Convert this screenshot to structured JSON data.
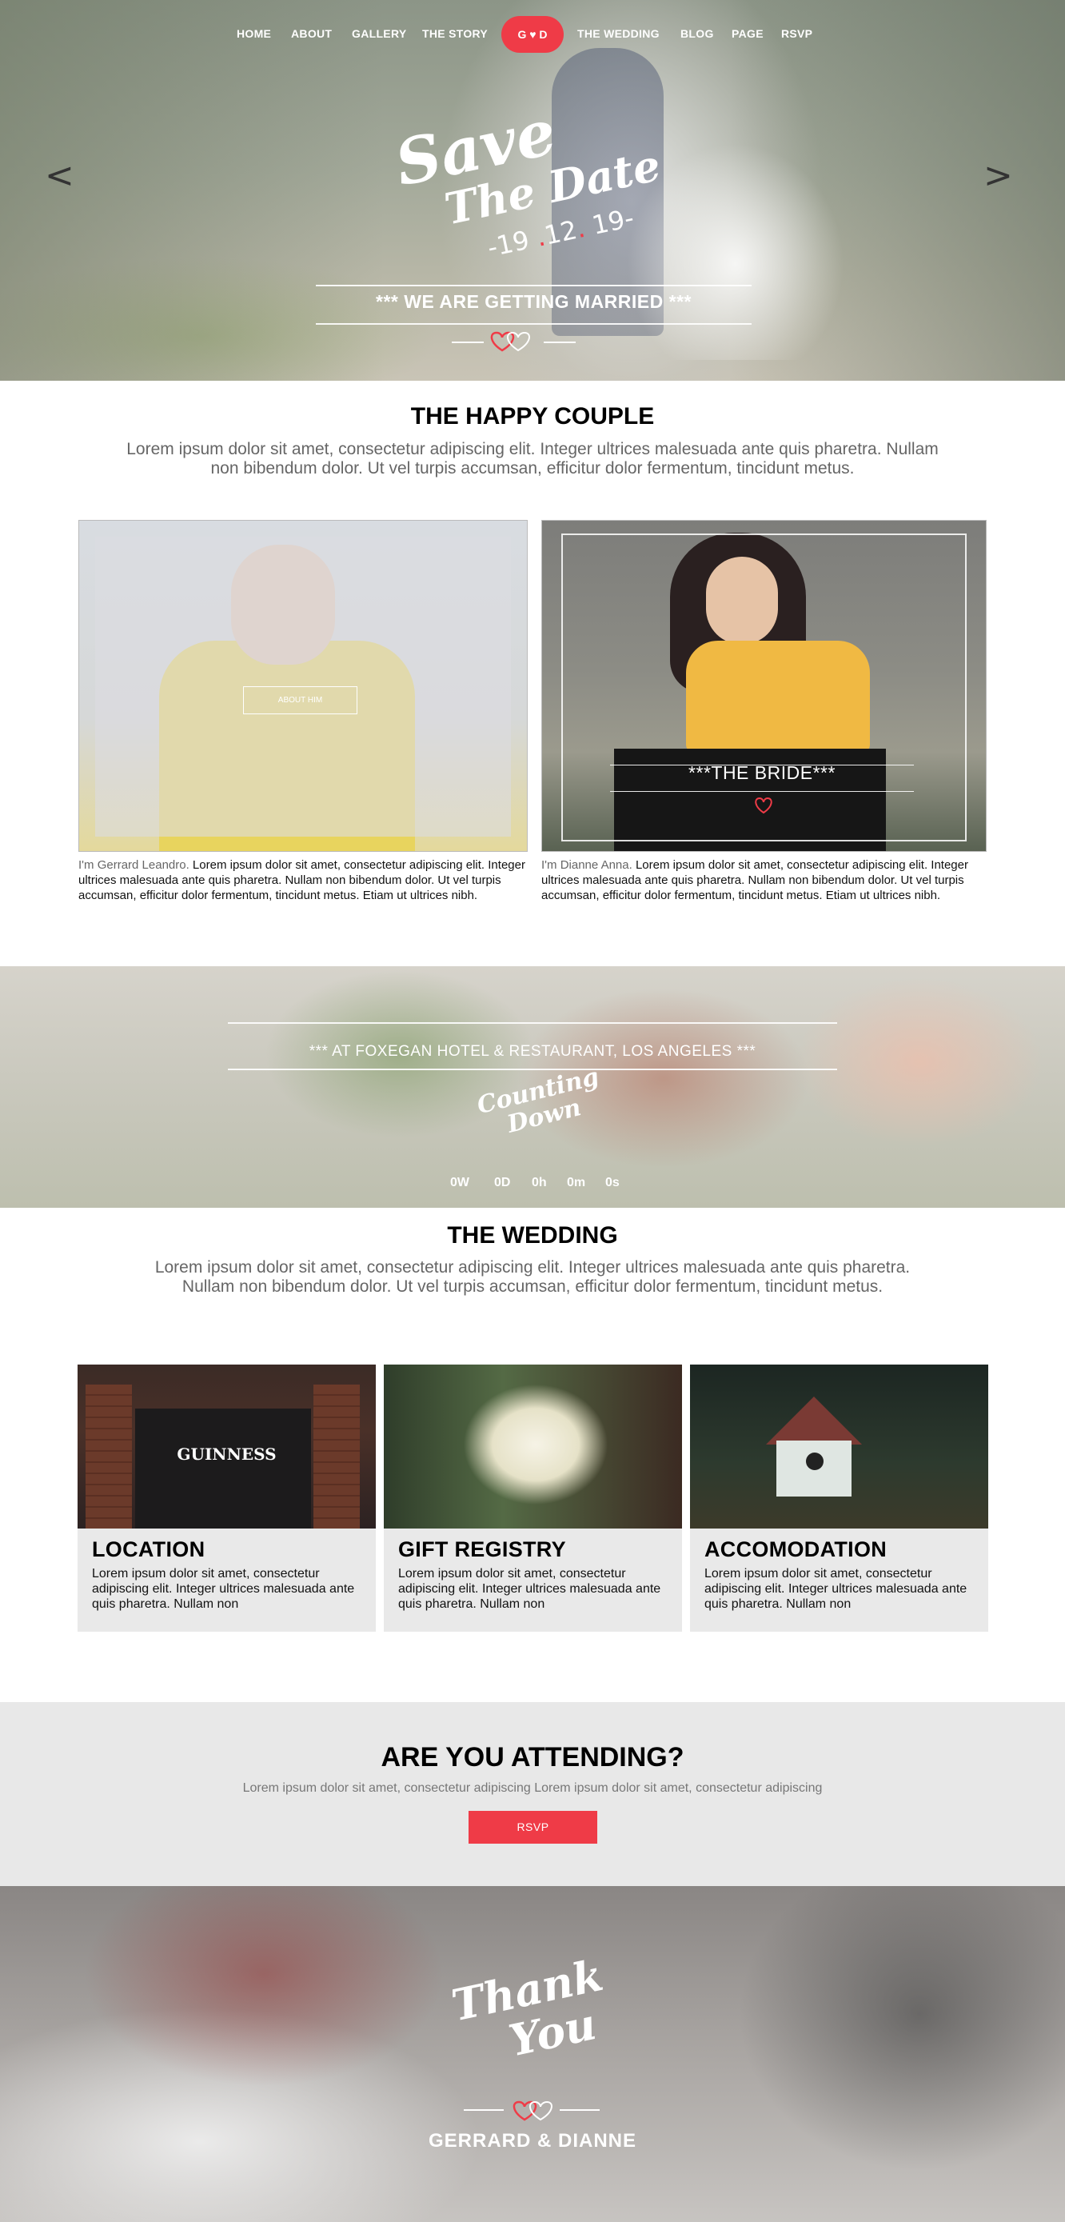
{
  "nav": {
    "items": [
      "HOME",
      "ABOUT",
      "GALLERY",
      "THE STORY",
      "THE WEDDING",
      "BLOG",
      "PAGE",
      "RSVP"
    ],
    "logo": "G ♥ D"
  },
  "hero": {
    "prev_arrow": "<",
    "next_arrow": ">",
    "save": "Save",
    "the_date": "The Date",
    "date_day": "19",
    "date_month": "12",
    "date_year": "19",
    "subtitle": "*** WE ARE GETTING MARRIED ***"
  },
  "couple": {
    "title": "THE HAPPY COUPLE",
    "lead": "Lorem ipsum dolor sit amet, consectetur adipiscing elit. Integer ultrices malesuada ante quis pharetra. Nullam non bibendum dolor. Ut vel turpis accumsan, efficitur dolor fermentum, tincidunt metus.",
    "groom": {
      "button": "ABOUT HIM",
      "intro": "I'm Gerrard Leandro.",
      "bio": " Lorem ipsum dolor sit amet, consectetur adipiscing elit. Integer ultrices malesuada ante quis pharetra. Nullam non bibendum dolor. Ut vel turpis accumsan, efficitur dolor fermentum, tincidunt metus. Etiam ut ultrices nibh."
    },
    "bride": {
      "label": "***THE BRIDE***",
      "intro": "I'm Dianne Anna.",
      "bio": " Lorem ipsum dolor sit amet, consectetur adipiscing elit. Integer ultrices malesuada ante quis pharetra. Nullam non bibendum dolor. Ut vel turpis accumsan, efficitur dolor fermentum, tincidunt metus. Etiam ut ultrices nibh."
    }
  },
  "countdown": {
    "venue": "*** AT FOXEGAN HOTEL & RESTAURANT, LOS ANGELES ***",
    "line1": "Counting",
    "line2": "Down",
    "weeks": "0W",
    "days": "0D",
    "hours": "0h",
    "minutes": "0m",
    "seconds": "0s"
  },
  "wedding": {
    "title": "THE WEDDING",
    "lead": "Lorem ipsum dolor sit amet, consectetur adipiscing elit. Integer ultrices malesuada ante quis pharetra. Nullam non bibendum dolor. Ut vel turpis accumsan, efficitur dolor fermentum, tincidunt metus.",
    "cards": [
      {
        "title": "LOCATION",
        "text": "Lorem ipsum dolor sit amet, consectetur adipiscing elit. Integer ultrices malesuada ante quis pharetra. Nullam non",
        "sign": "GUINNESS"
      },
      {
        "title": "GIFT REGISTRY",
        "text": "Lorem ipsum dolor sit amet, consectetur adipiscing elit. Integer ultrices malesuada ante quis pharetra. Nullam non"
      },
      {
        "title": "ACCOMODATION",
        "text": "Lorem ipsum dolor sit amet, consectetur adipiscing elit. Integer ultrices malesuada ante quis pharetra. Nullam non"
      }
    ]
  },
  "attend": {
    "title": "ARE YOU ATTENDING?",
    "text": "Lorem ipsum dolor sit amet, consectetur adipiscing Lorem ipsum dolor sit amet, consectetur adipiscing",
    "button": "RSVP"
  },
  "thanks": {
    "line1": "Thank",
    "line2": "You",
    "names": "GERRARD & DIANNE"
  },
  "colors": {
    "accent": "#ef3b47",
    "section_gray": "#e8e8e8"
  }
}
